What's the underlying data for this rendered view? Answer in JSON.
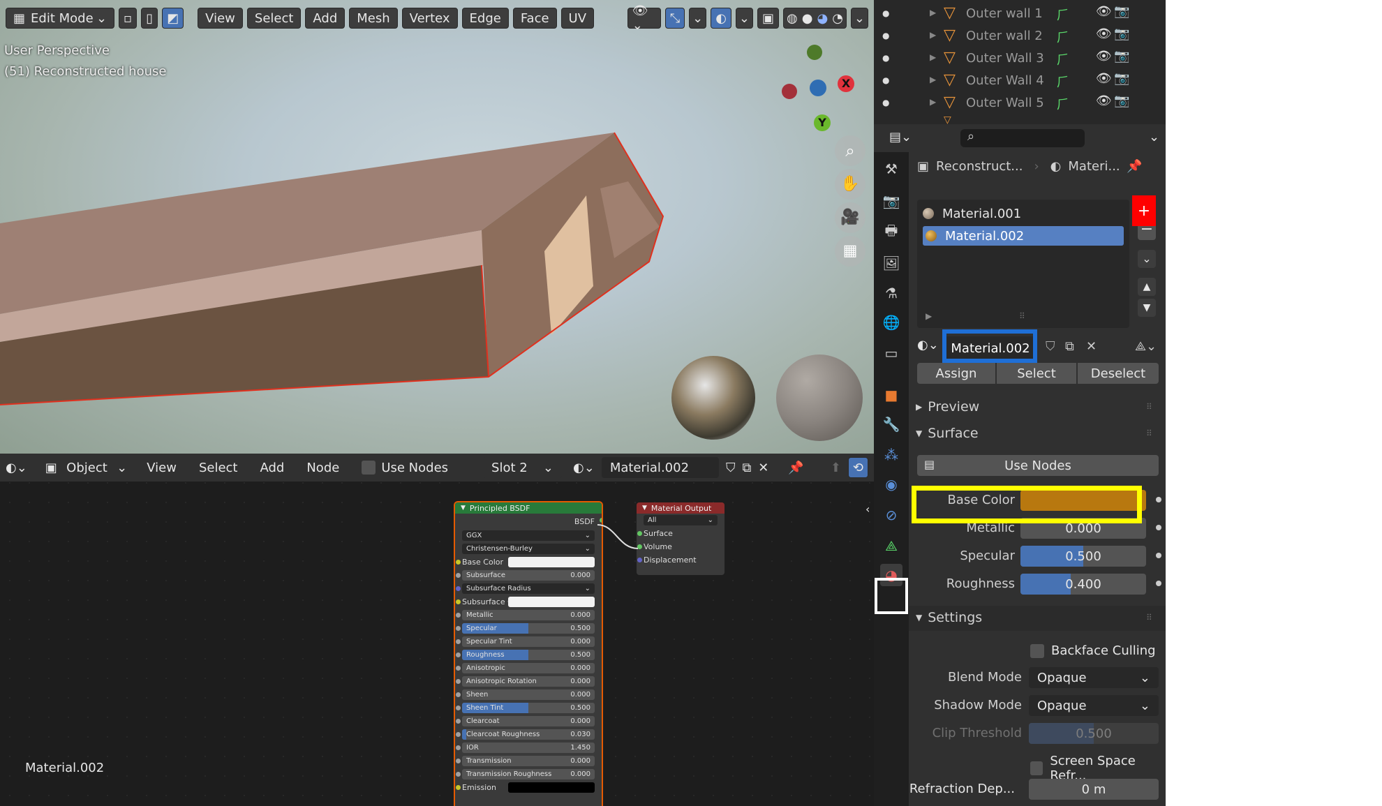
{
  "viewport": {
    "header": {
      "mode": "Edit Mode",
      "menus": [
        "View",
        "Select",
        "Add",
        "Mesh",
        "Vertex",
        "Edge",
        "Face",
        "UV"
      ]
    },
    "overlay_line1": "User Perspective",
    "overlay_line2": "(51) Reconstructed house",
    "gizmo": {
      "x": "X",
      "y": "Y"
    }
  },
  "node_editor": {
    "header": {
      "object_mode": "Object",
      "menus": [
        "View",
        "Select",
        "Add",
        "Node"
      ],
      "use_nodes": "Use Nodes",
      "slot": "Slot 2",
      "material": "Material.002"
    },
    "bsdf": {
      "title": "Principled BSDF",
      "output": "BSDF",
      "distribution": "GGX",
      "subsurface_method": "Christensen-Burley",
      "rows": [
        {
          "label": "Base Color",
          "type": "color",
          "color": "#f2f2f2"
        },
        {
          "label": "Subsurface",
          "value": "0.000",
          "fill": 0
        },
        {
          "label": "Subsurface Radius",
          "type": "dropdown"
        },
        {
          "label": "Subsurface C...",
          "type": "color",
          "color": "#f2f2f2"
        },
        {
          "label": "Metallic",
          "value": "0.000",
          "fill": 0
        },
        {
          "label": "Specular",
          "value": "0.500",
          "fill": 0.5
        },
        {
          "label": "Specular Tint",
          "value": "0.000",
          "fill": 0
        },
        {
          "label": "Roughness",
          "value": "0.500",
          "fill": 0.5
        },
        {
          "label": "Anisotropic",
          "value": "0.000",
          "fill": 0
        },
        {
          "label": "Anisotropic Rotation",
          "value": "0.000",
          "fill": 0
        },
        {
          "label": "Sheen",
          "value": "0.000",
          "fill": 0
        },
        {
          "label": "Sheen Tint",
          "value": "0.500",
          "fill": 0.5
        },
        {
          "label": "Clearcoat",
          "value": "0.000",
          "fill": 0
        },
        {
          "label": "Clearcoat Roughness",
          "value": "0.030",
          "fill": 0.03
        },
        {
          "label": "IOR",
          "value": "1.450",
          "fill": 0
        },
        {
          "label": "Transmission",
          "value": "0.000",
          "fill": 0
        },
        {
          "label": "Transmission Roughness",
          "value": "0.000",
          "fill": 0
        },
        {
          "label": "Emission",
          "type": "color",
          "color": "#000000"
        }
      ]
    },
    "output": {
      "title": "Material Output",
      "target": "All",
      "sockets": [
        "Surface",
        "Volume",
        "Displacement"
      ]
    },
    "footer_label": "Material.002"
  },
  "outliner": {
    "items": [
      "Outer wall 1",
      "Outer wall 2",
      "Outer Wall 3",
      "Outer Wall 4",
      "Outer Wall 5"
    ]
  },
  "properties": {
    "breadcrumb_object": "Reconstruct...",
    "breadcrumb_material": "Materi...",
    "slots": [
      "Material.001",
      "Material.002"
    ],
    "material_name": "Material.002",
    "assign_buttons": [
      "Assign",
      "Select",
      "Deselect"
    ],
    "preview_label": "Preview",
    "surface_label": "Surface",
    "use_nodes_label": "Use Nodes",
    "base_color_label": "Base Color",
    "base_color": "#b8780f",
    "metallic_label": "Metallic",
    "metallic_value": "0.000",
    "metallic_level": 0,
    "specular_label": "Specular",
    "specular_value": "0.500",
    "specular_level": 0.5,
    "roughness_label": "Roughness",
    "roughness_value": "0.400",
    "roughness_level": 0.4,
    "settings_label": "Settings",
    "backface_label": "Backface Culling",
    "blend_mode_label": "Blend Mode",
    "blend_mode": "Opaque",
    "shadow_mode_label": "Shadow Mode",
    "shadow_mode": "Opaque",
    "clip_label": "Clip Threshold",
    "clip_value": "0.500",
    "clip_level": 0.5,
    "ssr_label": "Screen Space Refr...",
    "refraction_label": "Refraction Dep...",
    "refraction_value": "0 m"
  },
  "annotations": {
    "red": "#ff0000",
    "blue": "#1f6fd6",
    "yellow": "#ffff00",
    "white": "#ffffff"
  }
}
